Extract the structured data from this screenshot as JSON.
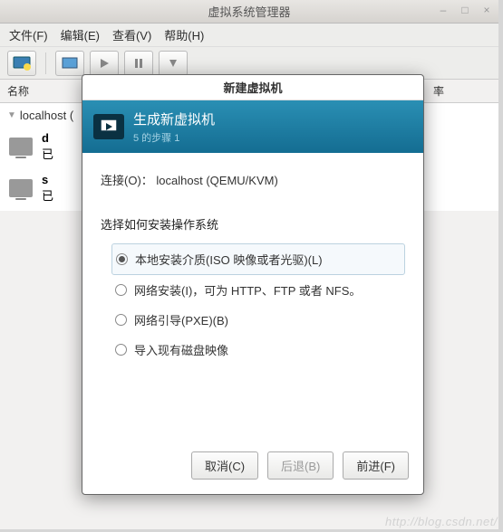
{
  "main_window": {
    "title": "虚拟系统管理器",
    "menus": {
      "file": "文件(F)",
      "edit": "编辑(E)",
      "view": "查看(V)",
      "help": "帮助(H)"
    },
    "table": {
      "col_name": "名称",
      "col_rate": "率",
      "group": "localhost (",
      "vm1": {
        "name": "d",
        "status": "已"
      },
      "vm2": {
        "name": "s",
        "status": "已"
      }
    }
  },
  "dialog": {
    "title": "新建虚拟机",
    "header": {
      "heading": "生成新虚拟机",
      "step": "5 的步骤 1"
    },
    "connection_label": "连接(O)：",
    "connection_value": "localhost (QEMU/KVM)",
    "section_label": "选择如何安装操作系统",
    "options": {
      "local": "本地安装介质(ISO 映像或者光驱)(L)",
      "network": "网络安装(I)，可为 HTTP、FTP 或者 NFS。",
      "pxe": "网络引导(PXE)(B)",
      "import": "导入现有磁盘映像"
    },
    "buttons": {
      "cancel": "取消(C)",
      "back": "后退(B)",
      "forward": "前进(F)"
    }
  },
  "watermark": "http://blog.csdn.net/"
}
